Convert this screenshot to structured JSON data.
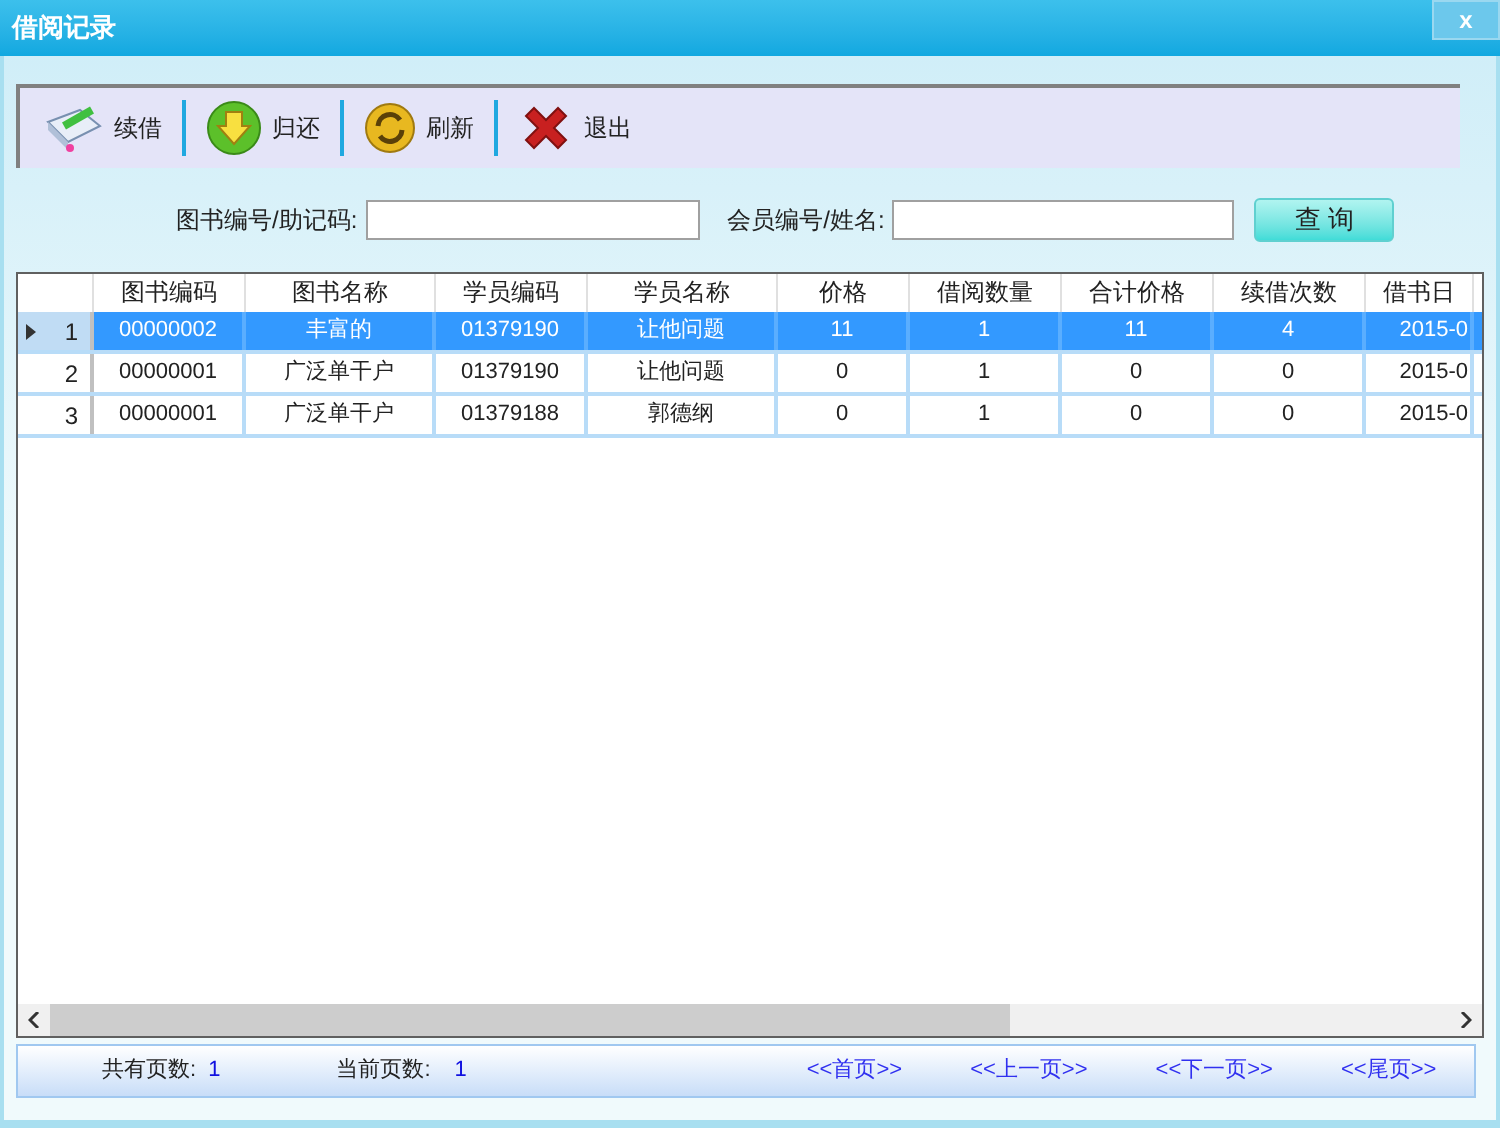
{
  "window": {
    "title": "借阅记录",
    "close": "x"
  },
  "toolbar": [
    {
      "kind": "renew",
      "label": "续借"
    },
    {
      "kind": "return",
      "label": "归还"
    },
    {
      "kind": "refresh",
      "label": "刷新"
    },
    {
      "kind": "exit",
      "label": "退出"
    }
  ],
  "search": {
    "book_label": "图书编号/助记码:",
    "member_label": "会员编号/姓名:",
    "button": "查 询"
  },
  "table": {
    "columns": [
      "图书编码",
      "图书名称",
      "学员编码",
      "学员名称",
      "价格",
      "借阅数量",
      "合计价格",
      "续借次数",
      "借书日"
    ],
    "rows": [
      {
        "number": "1",
        "selected": true,
        "cells": [
          "00000002",
          "丰富的",
          "01379190",
          "让他问题",
          "11",
          "1",
          "11",
          "4",
          "2015-0"
        ]
      },
      {
        "number": "2",
        "selected": false,
        "cells": [
          "00000001",
          "广泛单干户",
          "01379190",
          "让他问题",
          "0",
          "1",
          "0",
          "0",
          "2015-0"
        ]
      },
      {
        "number": "3",
        "selected": false,
        "cells": [
          "00000001",
          "广泛单干户",
          "01379188",
          "郭德纲",
          "0",
          "1",
          "0",
          "0",
          "2015-0"
        ]
      }
    ]
  },
  "footer": {
    "total_label": "共有页数:",
    "total": "1",
    "current_label": "当前页数:",
    "current": "1",
    "links": [
      "<<首页>>",
      "<<上一页>>",
      "<<下一页>>",
      "<<尾页>>"
    ]
  }
}
